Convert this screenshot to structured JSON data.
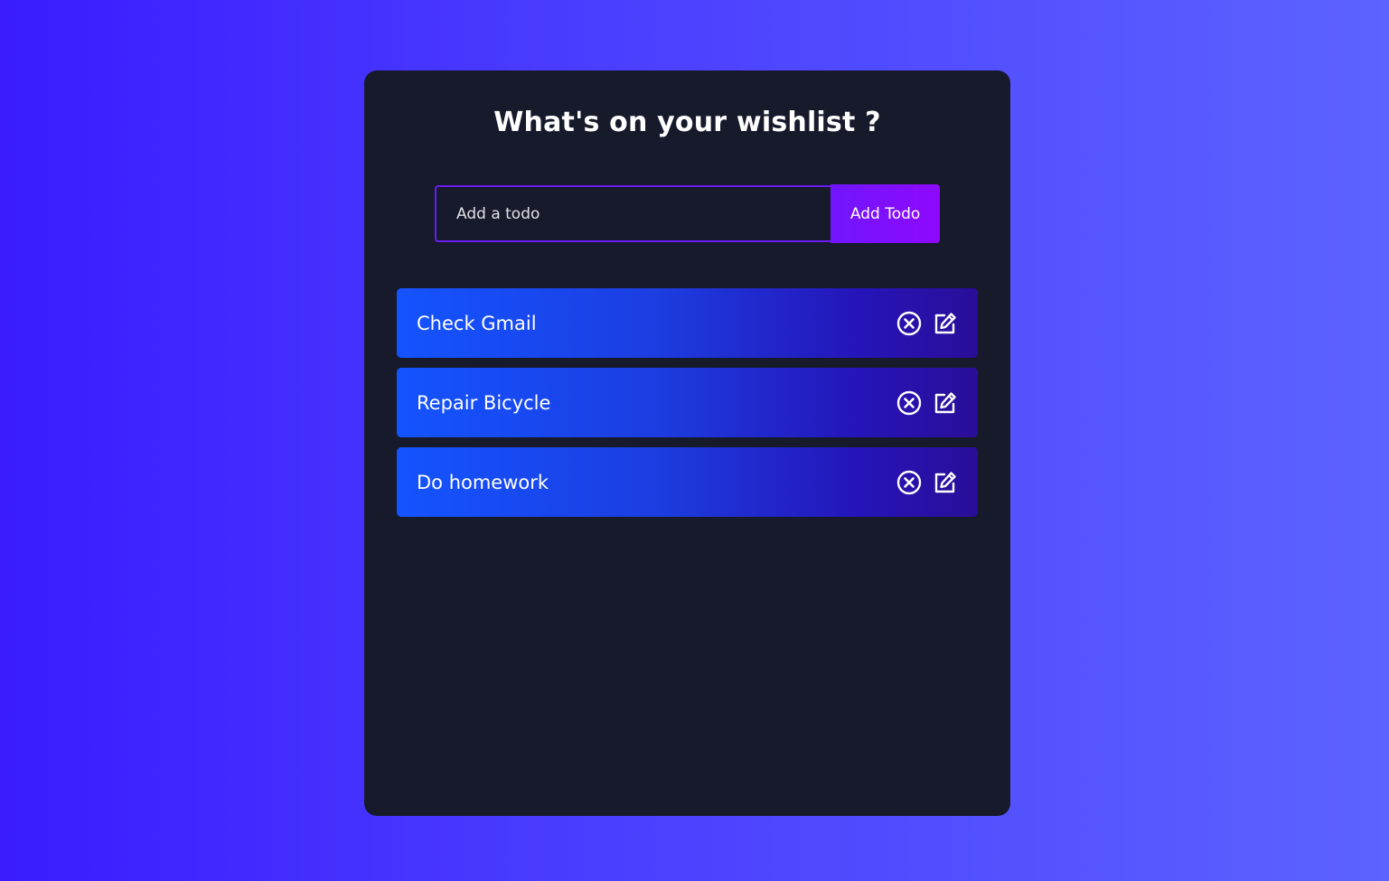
{
  "page": {
    "title": "What's on your wishlist ?"
  },
  "form": {
    "input_placeholder": "Add a todo",
    "input_value": "",
    "add_button_label": "Add Todo"
  },
  "todos": [
    {
      "text": "Check Gmail",
      "delete_icon": "close-circle-icon",
      "edit_icon": "edit-icon"
    },
    {
      "text": "Repair Bicycle",
      "delete_icon": "close-circle-icon",
      "edit_icon": "edit-icon"
    },
    {
      "text": "Do homework",
      "delete_icon": "close-circle-icon",
      "edit_icon": "edit-icon"
    }
  ],
  "colors": {
    "background_start": "#3a1cff",
    "background_end": "#5c63ff",
    "card": "#161a2b",
    "accent": "#7115ff",
    "row_start": "#1454ff",
    "row_end": "#2a0e98",
    "text": "#ffffff"
  }
}
